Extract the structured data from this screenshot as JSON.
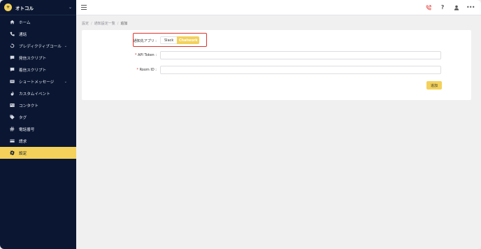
{
  "brand": {
    "name": "オトコル",
    "logo_glyph": "✳",
    "accent": "#f3d15a"
  },
  "sidebar": {
    "items": [
      {
        "label": "ホーム",
        "icon": "home-icon"
      },
      {
        "label": "通話",
        "icon": "phone-icon"
      },
      {
        "label": "プレディクティブコール",
        "icon": "phone-sync-icon",
        "has_submenu": true
      },
      {
        "label": "発信スクリプト",
        "icon": "message-icon"
      },
      {
        "label": "着信スクリプト",
        "icon": "message-icon"
      },
      {
        "label": "ショートメッセージ",
        "icon": "sms-icon",
        "has_submenu": true
      },
      {
        "label": "カスタムイベント",
        "icon": "fire-icon"
      },
      {
        "label": "コンタクト",
        "icon": "contact-card-icon"
      },
      {
        "label": "タグ",
        "icon": "tag-icon"
      },
      {
        "label": "電話番号",
        "icon": "hash-icon"
      },
      {
        "label": "請求",
        "icon": "credit-card-icon"
      },
      {
        "label": "設定",
        "icon": "gear-icon",
        "active": true
      }
    ]
  },
  "breadcrumb": {
    "items": [
      "設定",
      "通知設定一覧",
      "追加"
    ]
  },
  "form": {
    "app_label": "通知先アプリ :",
    "app_options": [
      {
        "label": "Slack",
        "selected": false
      },
      {
        "label": "Chatwork",
        "selected": true
      }
    ],
    "api_token_label": "API Token :",
    "api_token_value": "",
    "room_id_label": "Room ID :",
    "room_id_value": "",
    "required_mark": "*",
    "submit_label": "追加"
  },
  "colors": {
    "sidebar_bg": "#0b1732",
    "highlight_border": "#e0322b",
    "phone_icon": "#e0322b"
  }
}
